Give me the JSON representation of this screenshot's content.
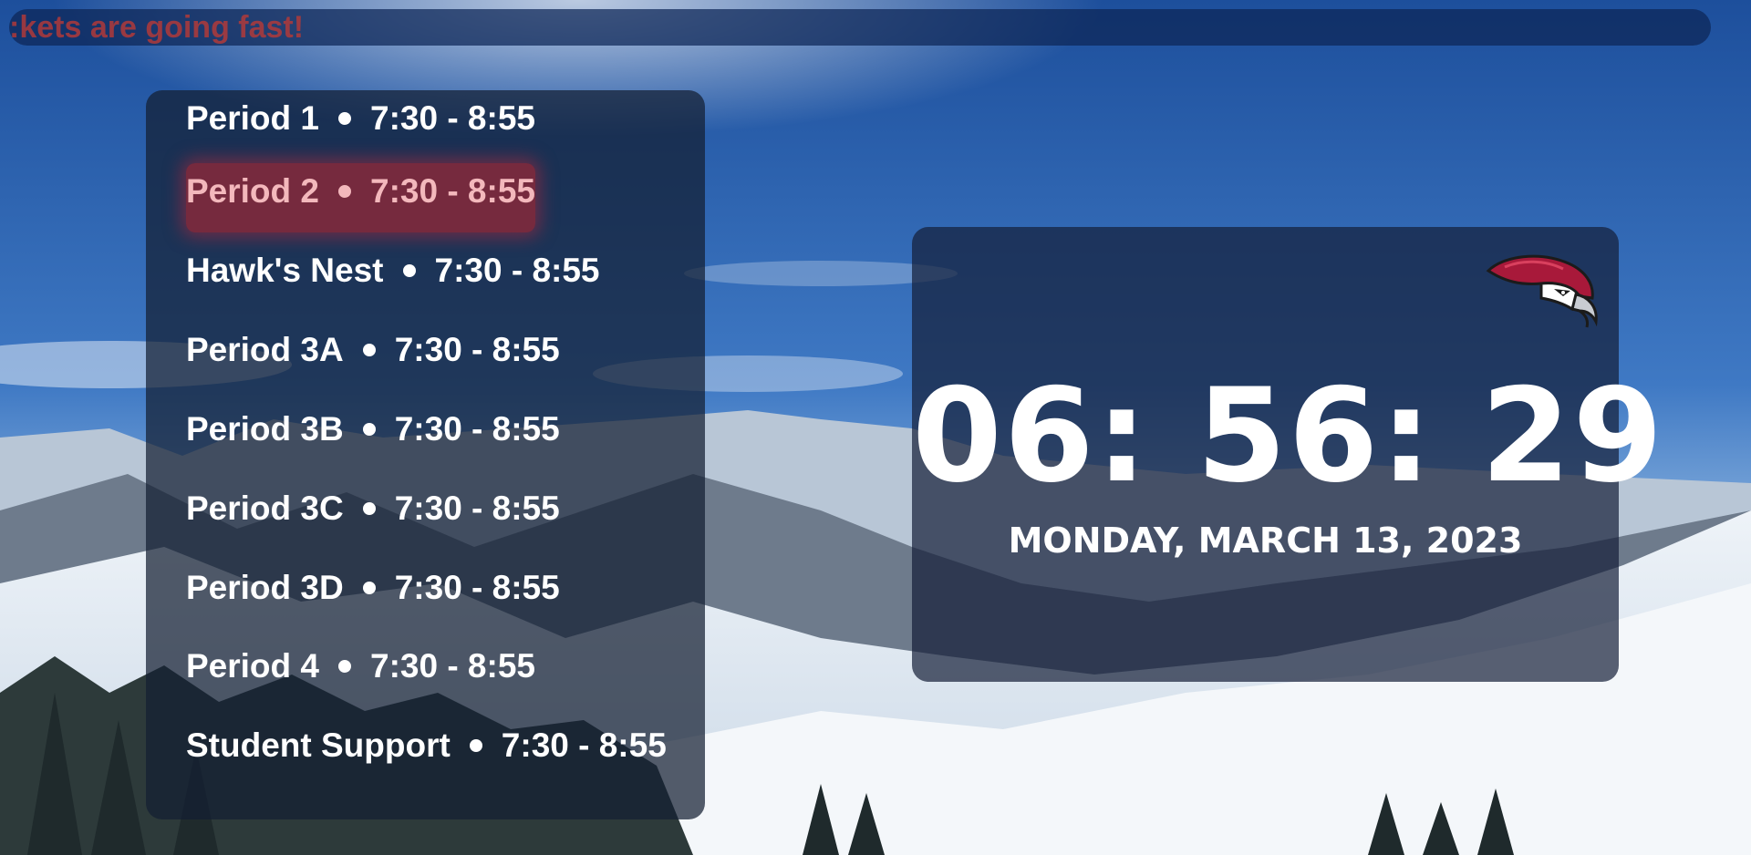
{
  "ticker": {
    "text": ":kets are going fast!"
  },
  "schedule": {
    "periods": [
      {
        "name": "Period 1",
        "time": "7:30 - 8:55",
        "current": false
      },
      {
        "name": "Period 2",
        "time": "7:30 - 8:55",
        "current": true
      },
      {
        "name": "Hawk's Nest",
        "time": "7:30 - 8:55",
        "current": false
      },
      {
        "name": "Period 3A",
        "time": "7:30 - 8:55",
        "current": false
      },
      {
        "name": "Period 3B",
        "time": "7:30 - 8:55",
        "current": false
      },
      {
        "name": "Period 3C",
        "time": "7:30 - 8:55",
        "current": false
      },
      {
        "name": "Period 3D",
        "time": "7:30 - 8:55",
        "current": false
      },
      {
        "name": "Period 4",
        "time": "7:30 - 8:55",
        "current": false
      },
      {
        "name": "Student Support",
        "time": "7:30 - 8:55",
        "current": false
      }
    ]
  },
  "clock": {
    "time": "06: 56: 29",
    "date": "MONDAY, MARCH 13, 2023",
    "logo_icon": "hawk-mascot-icon"
  },
  "colors": {
    "panel": "#141e32",
    "ticker_text": "#b03a3a",
    "current_period_highlight": "#962837",
    "current_period_text": "#f3b8bc",
    "text": "#ffffff"
  },
  "background": {
    "scene": "snowy-mountain-landscape"
  }
}
